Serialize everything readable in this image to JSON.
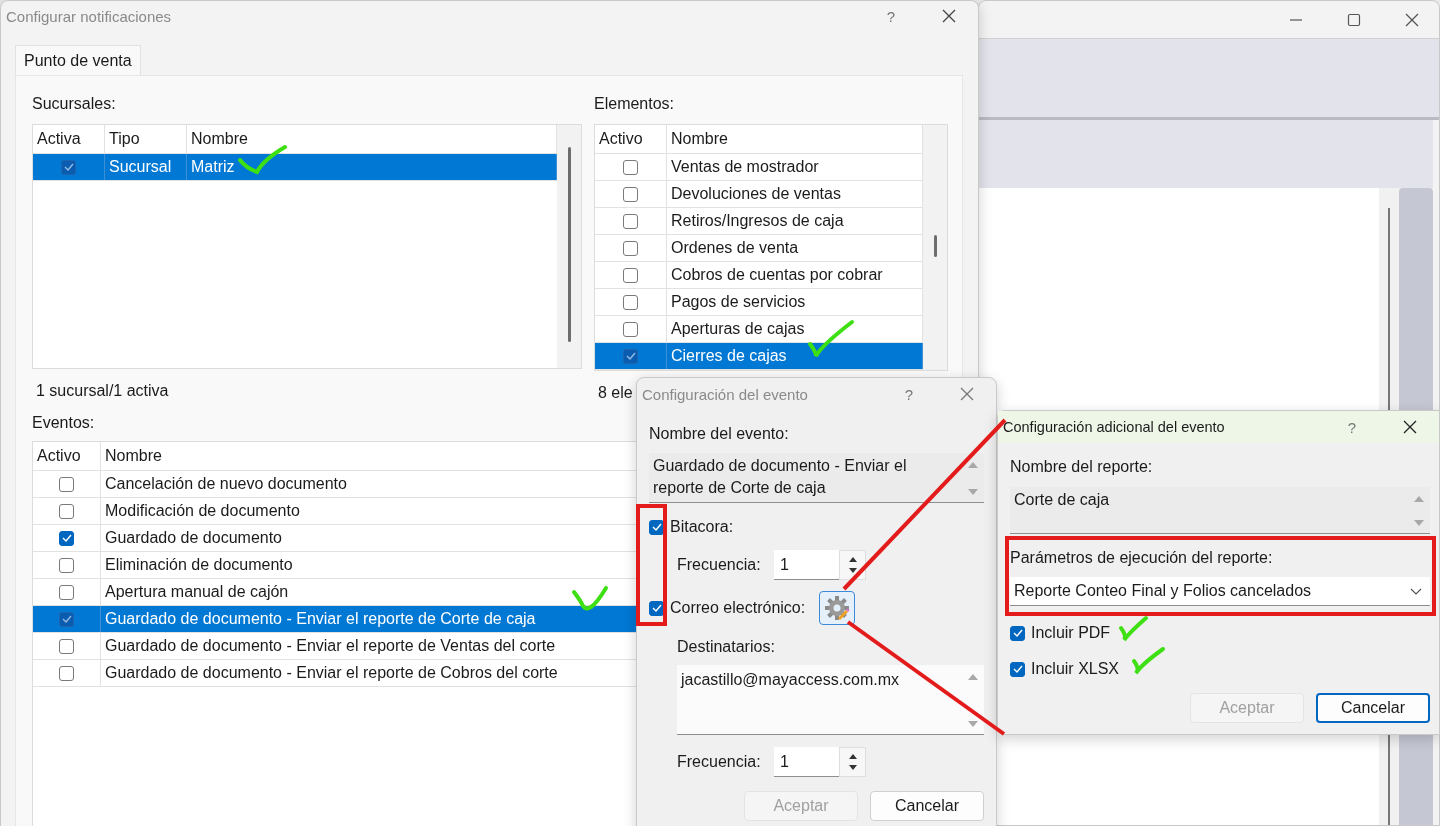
{
  "dialog": {
    "title": "Configurar notificaciones",
    "help": "?",
    "tabs": [
      {
        "label": "Punto de venta",
        "selected": true
      }
    ],
    "sucursales": {
      "label": "Sucursales:",
      "columns": [
        "Activa",
        "Tipo",
        "Nombre"
      ],
      "summary": "1 sucursal/1 activa",
      "rows": [
        {
          "active": true,
          "selected": true,
          "type": "Sucursal",
          "name": "Matriz"
        }
      ]
    },
    "elementos": {
      "label": "Elementos:",
      "columns": [
        "Activo",
        "Nombre"
      ],
      "summary": "8 ele",
      "rows": [
        {
          "active": false,
          "selected": false,
          "name": "Ventas de mostrador"
        },
        {
          "active": false,
          "selected": false,
          "name": "Devoluciones de ventas"
        },
        {
          "active": false,
          "selected": false,
          "name": "Retiros/Ingresos de caja"
        },
        {
          "active": false,
          "selected": false,
          "name": "Ordenes de venta"
        },
        {
          "active": false,
          "selected": false,
          "name": "Cobros de cuentas por cobrar"
        },
        {
          "active": false,
          "selected": false,
          "name": "Pagos de servicios"
        },
        {
          "active": false,
          "selected": false,
          "name": "Aperturas de cajas"
        },
        {
          "active": true,
          "selected": true,
          "name": "Cierres de cajas"
        }
      ]
    },
    "eventos": {
      "label": "Eventos:",
      "columns": [
        "Activo",
        "Nombre"
      ],
      "rows": [
        {
          "active": false,
          "selected": false,
          "name": "Cancelación de nuevo documento"
        },
        {
          "active": false,
          "selected": false,
          "name": "Modificación de documento"
        },
        {
          "active": true,
          "selected": false,
          "name": "Guardado de documento"
        },
        {
          "active": false,
          "selected": false,
          "name": "Eliminación de documento"
        },
        {
          "active": false,
          "selected": false,
          "name": "Apertura manual de cajón"
        },
        {
          "active": true,
          "selected": true,
          "name": "Guardado de documento - Enviar el reporte de Corte de caja"
        },
        {
          "active": false,
          "selected": false,
          "name": "Guardado de documento - Enviar el reporte de Ventas del corte"
        },
        {
          "active": false,
          "selected": false,
          "name": "Guardado de documento - Enviar el reporte de Cobros del corte"
        }
      ]
    }
  },
  "event_dialog": {
    "title": "Configuración del evento",
    "help": "?",
    "name_label": "Nombre del evento:",
    "event_name": "Guardado de documento - Enviar el reporte de Corte de caja",
    "log": {
      "label": "Bitacora:",
      "checked": true,
      "frequency_label": "Frecuencia:",
      "frequency": "1"
    },
    "email": {
      "label": "Correo electrónico:",
      "checked": true,
      "recipients_label": "Destinatarios:",
      "recipients": "jacastillo@mayaccess.com.mx",
      "frequency_label": "Frecuencia:",
      "frequency": "1"
    },
    "buttons": [
      {
        "label": "Aceptar",
        "disabled": true,
        "default": false
      },
      {
        "label": "Cancelar",
        "disabled": false,
        "default": false
      }
    ]
  },
  "additional_dialog": {
    "title": "Configuración adicional del evento",
    "help": "?",
    "report_label": "Nombre del reporte:",
    "report_name": "Corte de caja",
    "params_label": "Parámetros de ejecución del reporte:",
    "params_value": "Reporte Conteo Final y Folios cancelados",
    "options": [
      {
        "label": "Incluir PDF",
        "checked": true
      },
      {
        "label": "Incluir XLSX",
        "checked": true
      }
    ],
    "buttons": [
      {
        "label": "Aceptar",
        "disabled": true,
        "default": false
      },
      {
        "label": "Cancelar",
        "disabled": false,
        "default": true
      }
    ]
  }
}
